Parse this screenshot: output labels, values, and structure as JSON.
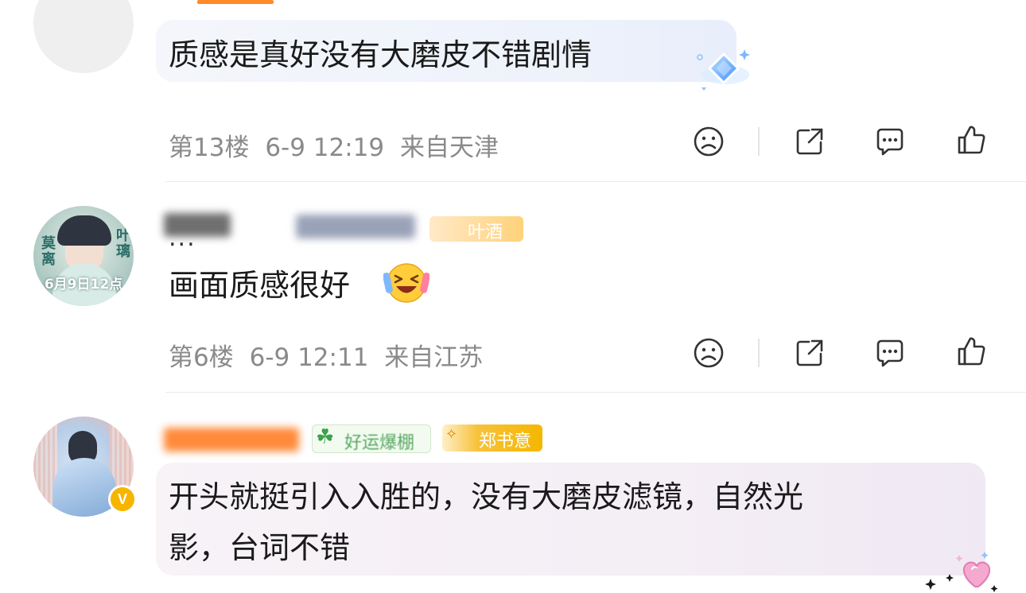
{
  "comments": [
    {
      "text": "质感是真好没有大磨皮不错剧情",
      "floor": "第13楼",
      "time": "6-9 12:19",
      "location": "来自天津"
    },
    {
      "username": "...",
      "avatar_caption": "6月9日12点",
      "badge": "叶酒",
      "text": "画面质感很好",
      "floor": "第6楼",
      "time": "6-9 12:11",
      "location": "来自江苏"
    },
    {
      "badge_luck": "好运爆棚",
      "badge_fan": "郑书意",
      "verified": "V",
      "text_line1": "开头就挺引入入胜的，没有大磨皮滤镜，自然光",
      "text_line2": "影，台词不错"
    }
  ],
  "icons": {
    "dislike": "sad-face-icon",
    "share": "share-icon",
    "comment": "comment-icon",
    "like": "thumbs-up-icon"
  },
  "colors": {
    "meta_text": "#8a8a8a",
    "icon": "#333333",
    "verified": "#f7b500",
    "fan_badge": "#f5b700"
  }
}
